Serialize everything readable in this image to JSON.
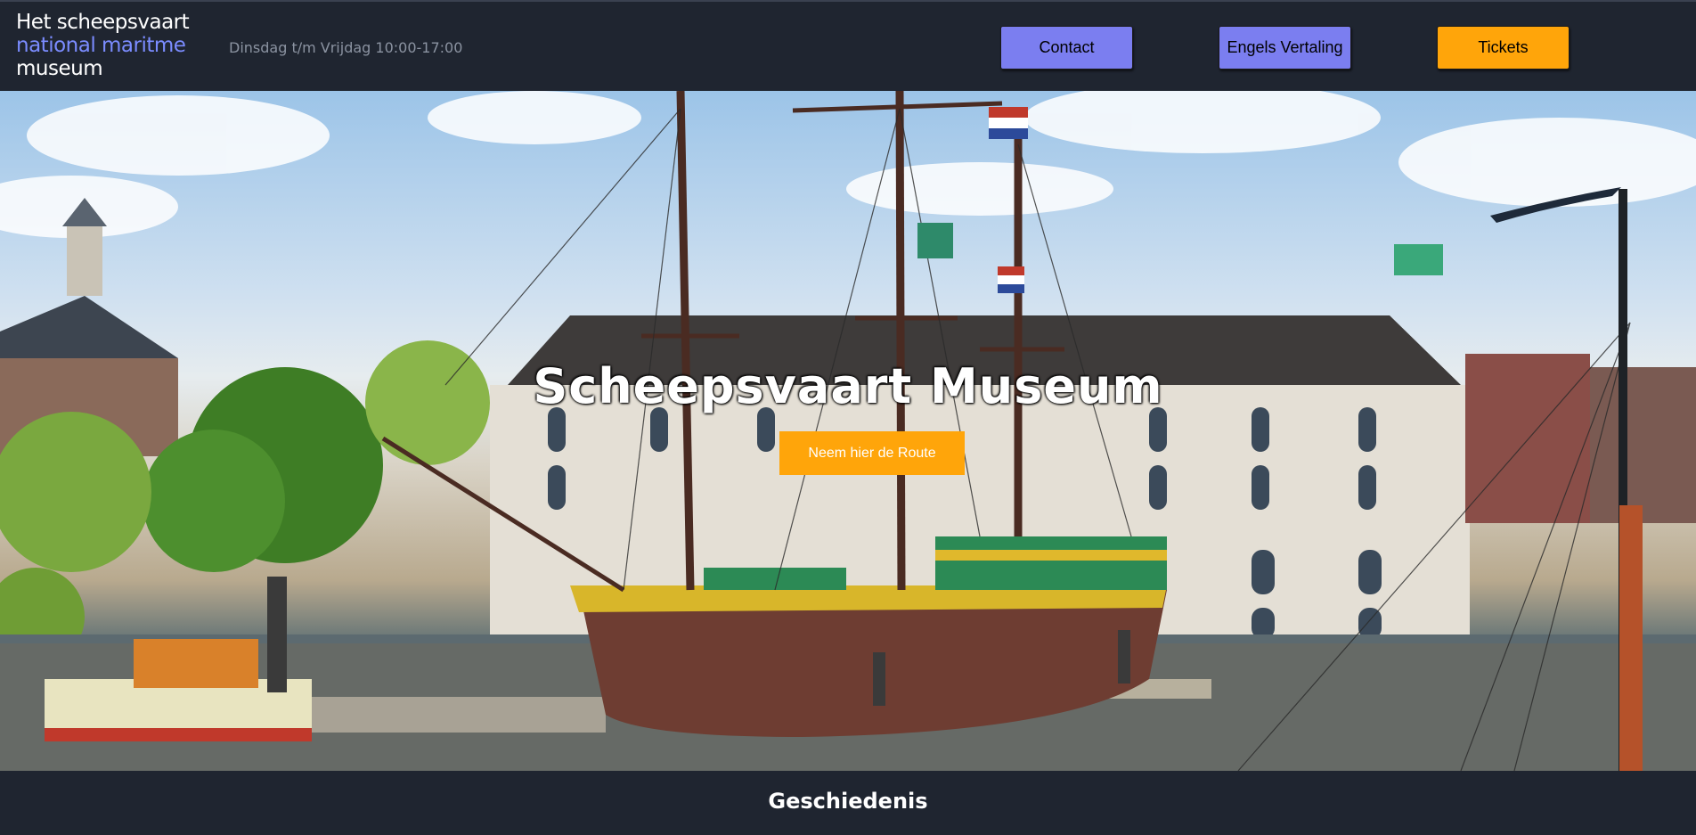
{
  "header": {
    "logo": {
      "line1": "Het scheepsvaart",
      "line2": "national maritme",
      "line3": "museum"
    },
    "hours": "Dinsdag t/m Vrijdag 10:00-17:00",
    "buttons": {
      "contact": "Contact",
      "engels": "Engels Vertaling",
      "tickets": "Tickets"
    }
  },
  "hero": {
    "title": "Scheepsvaart Museum",
    "route_button": "Neem hier de Route",
    "image": "maritime-museum-photo"
  },
  "footer": {
    "heading": "Geschiedenis"
  },
  "colors": {
    "background": "#1f2530",
    "accent_blue": "#7b7ef0",
    "accent_orange": "#ffa50a",
    "logo_blue": "#7b8cff"
  }
}
